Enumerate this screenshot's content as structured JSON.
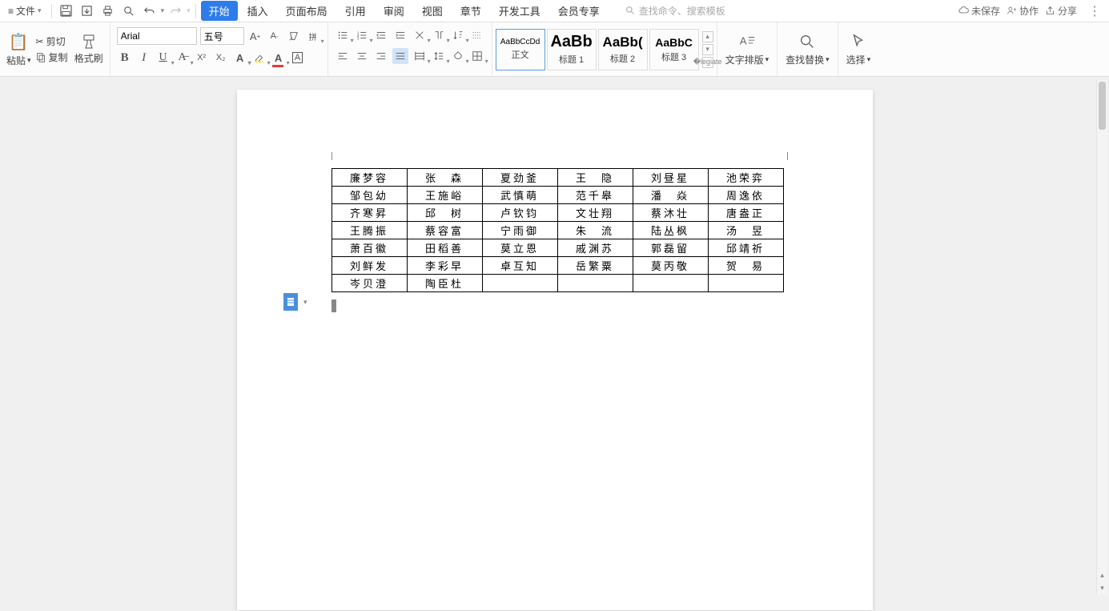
{
  "menu": {
    "file": "文件",
    "tabs": [
      "开始",
      "插入",
      "页面布局",
      "引用",
      "审阅",
      "视图",
      "章节",
      "开发工具",
      "会员专享"
    ],
    "active_tab": 0
  },
  "search": {
    "placeholder": "查找命令、搜索模板"
  },
  "status": {
    "unsaved": "未保存",
    "coop": "协作",
    "share": "分享"
  },
  "clipboard": {
    "paste": "粘贴",
    "cut": "剪切",
    "copy": "复制",
    "format_painter": "格式刷"
  },
  "font": {
    "name": "Arial",
    "size": "五号",
    "bold": "B",
    "italic": "I",
    "underline": "U"
  },
  "styles": {
    "items": [
      {
        "preview": "AaBbCcDd",
        "label": "正文",
        "fs": "10px"
      },
      {
        "preview": "AaBb",
        "label": "标题 1",
        "fs": "20px",
        "bold": true
      },
      {
        "preview": "AaBb(",
        "label": "标题 2",
        "fs": "17px",
        "bold": true
      },
      {
        "preview": "AaBbC",
        "label": "标题 3",
        "fs": "14px",
        "bold": true
      }
    ]
  },
  "tools": {
    "layout": "文字排版",
    "find": "查找替换",
    "select": "选择"
  },
  "table": {
    "rows": [
      [
        "廉梦容",
        "张　森",
        "夏劲釜",
        "王　隐",
        "刘昼星",
        "池荣弈"
      ],
      [
        "邹包幼",
        "王施峪",
        "武慎萌",
        "范千皋",
        "潘　焱",
        "周逸依"
      ],
      [
        "齐寒昇",
        "邱　树",
        "卢钦钧",
        "文壮翔",
        "蔡沐壮",
        "唐盎正"
      ],
      [
        "王腾振",
        "蔡容富",
        "宁雨御",
        "朱　流",
        "陆丛枫",
        "汤　昱"
      ],
      [
        "萧百徽",
        "田稻善",
        "莫立恩",
        "戚渊苏",
        "郭磊留",
        "邱靖祈"
      ],
      [
        "刘鲜发",
        "李彩早",
        "卓互知",
        "岳繁粟",
        "莫丙敬",
        "贺　易"
      ],
      [
        "岑贝澄",
        "陶臣杜",
        "",
        "",
        "",
        ""
      ]
    ]
  }
}
